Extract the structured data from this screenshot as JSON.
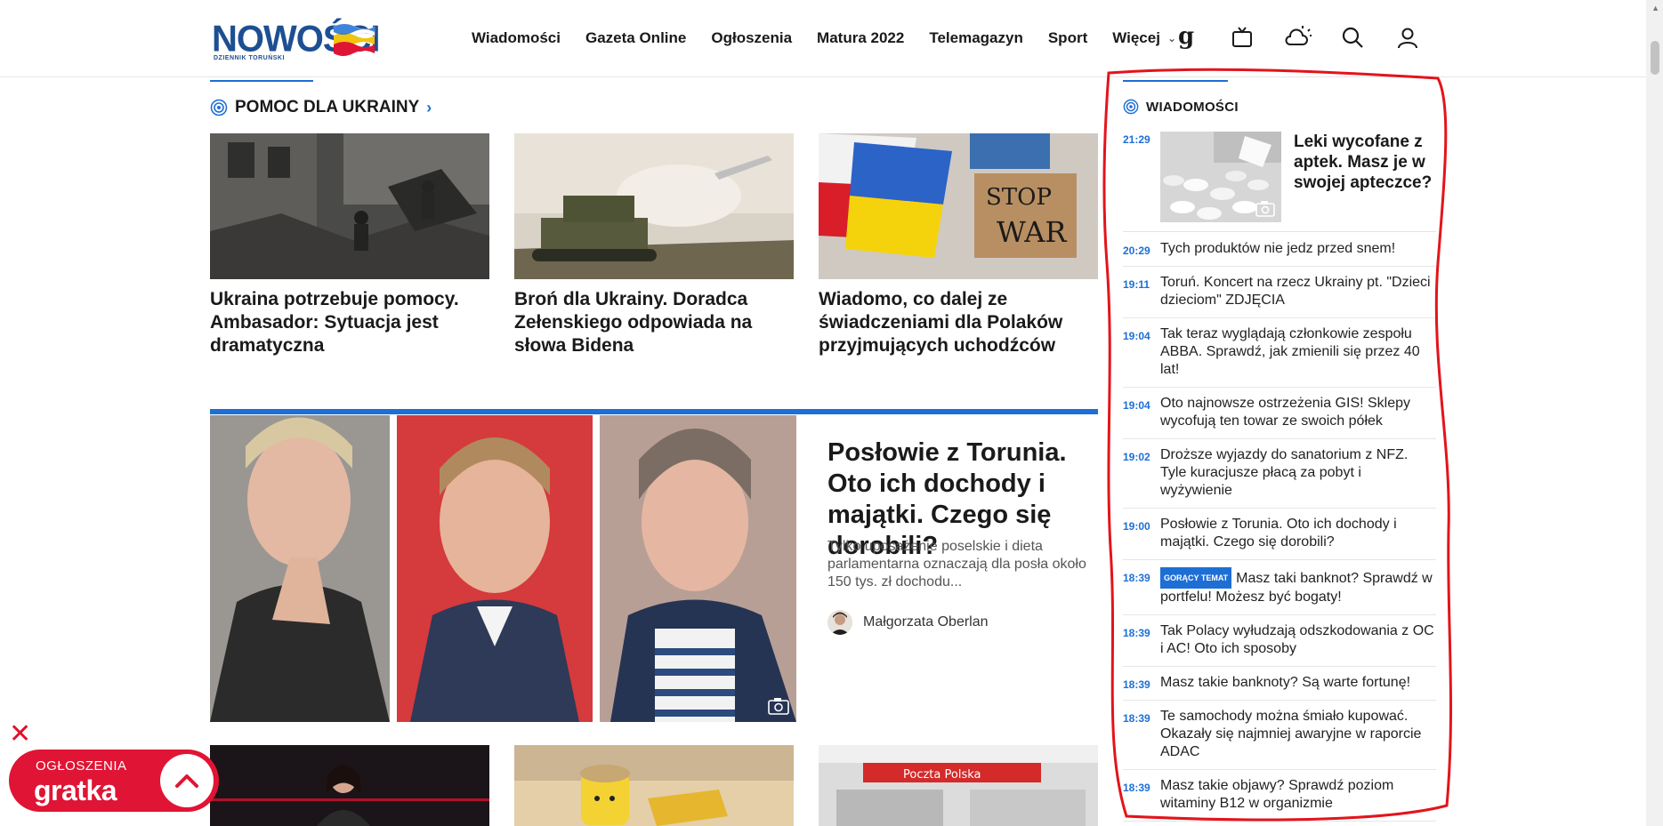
{
  "header": {
    "logo": {
      "name": "NOWOŚCI",
      "sub": "DZIENNIK TORUŃSKI"
    },
    "nav": [
      "Wiadomości",
      "Gazeta Online",
      "Ogłoszenia",
      "Matura 2022",
      "Telemagazyn",
      "Sport"
    ],
    "nav_more": "Więcej",
    "icons": [
      "g-logo-icon",
      "tv-icon",
      "weather-icon",
      "search-icon",
      "user-icon"
    ]
  },
  "section": {
    "title": "POMOC DLA UKRAINY",
    "cards": [
      {
        "title": "Ukraina potrzebuje pomocy. Ambasador: Sytuacja jest dramatyczna"
      },
      {
        "title": "Broń dla Ukrainy. Doradca Zełenskiego odpowiada na słowa Bidena"
      },
      {
        "title": "Wiadomo, co dalej ze świadczeniami dla Polaków przyjmujących uchodźców"
      }
    ]
  },
  "feature": {
    "title": "Posłowie z Torunia. Oto ich dochody i majątki. Czego się dorobili?",
    "lead": "Tylko uposażenie poselskie i dieta parlamentarna oznaczają dla posła około 150 tys. zł dochodu...",
    "author": "Małgorzata Oberlan"
  },
  "sidebar": {
    "title": "WIADOMOŚCI",
    "top": {
      "time": "21:29",
      "title": "Leki wycofane z aptek. Masz je w swojej apteczce?"
    },
    "items": [
      {
        "time": "20:29",
        "text": "Tych produktów nie jedz przed snem!"
      },
      {
        "time": "19:11",
        "text": "Toruń. Koncert na rzecz Ukrainy pt. \"Dzieci dzieciom\" ZDJĘCIA"
      },
      {
        "time": "19:04",
        "text": "Tak teraz wyglądają członkowie zespołu ABBA. Sprawdź, jak zmienili się przez 40 lat!"
      },
      {
        "time": "19:04",
        "text": "Oto najnowsze ostrzeżenia GIS! Sklepy wycofują ten towar ze swoich półek"
      },
      {
        "time": "19:02",
        "text": "Droższe wyjazdy do sanatorium z NFZ. Tyle kuracjusze płacą za pobyt i wyżywienie"
      },
      {
        "time": "19:00",
        "text": "Posłowie z Torunia. Oto ich dochody i majątki. Czego się dorobili?"
      },
      {
        "time": "18:39",
        "badge": "GORĄCY TEMAT",
        "text": "Masz taki banknot? Sprawdź w portfelu! Możesz być bogaty!"
      },
      {
        "time": "18:39",
        "text": "Tak Polacy wyłudzają odszkodowania z OC i AC! Oto ich sposoby"
      },
      {
        "time": "18:39",
        "text": "Masz takie banknoty? Są warte fortunę!"
      },
      {
        "time": "18:39",
        "text": "Te samochody można śmiało kupować. Okazały się najmniej awaryjne w raporcie ADAC"
      },
      {
        "time": "18:39",
        "text": "Masz takie objawy? Sprawdź poziom witaminy B12 w organizmie"
      }
    ]
  },
  "ad": {
    "small": "OGŁOSZENIA",
    "brand": "gratka"
  },
  "colors": {
    "accent": "#1d6fd6",
    "brand": "#1d4f91",
    "ad": "#e01434",
    "annotation": "#e3141b"
  }
}
